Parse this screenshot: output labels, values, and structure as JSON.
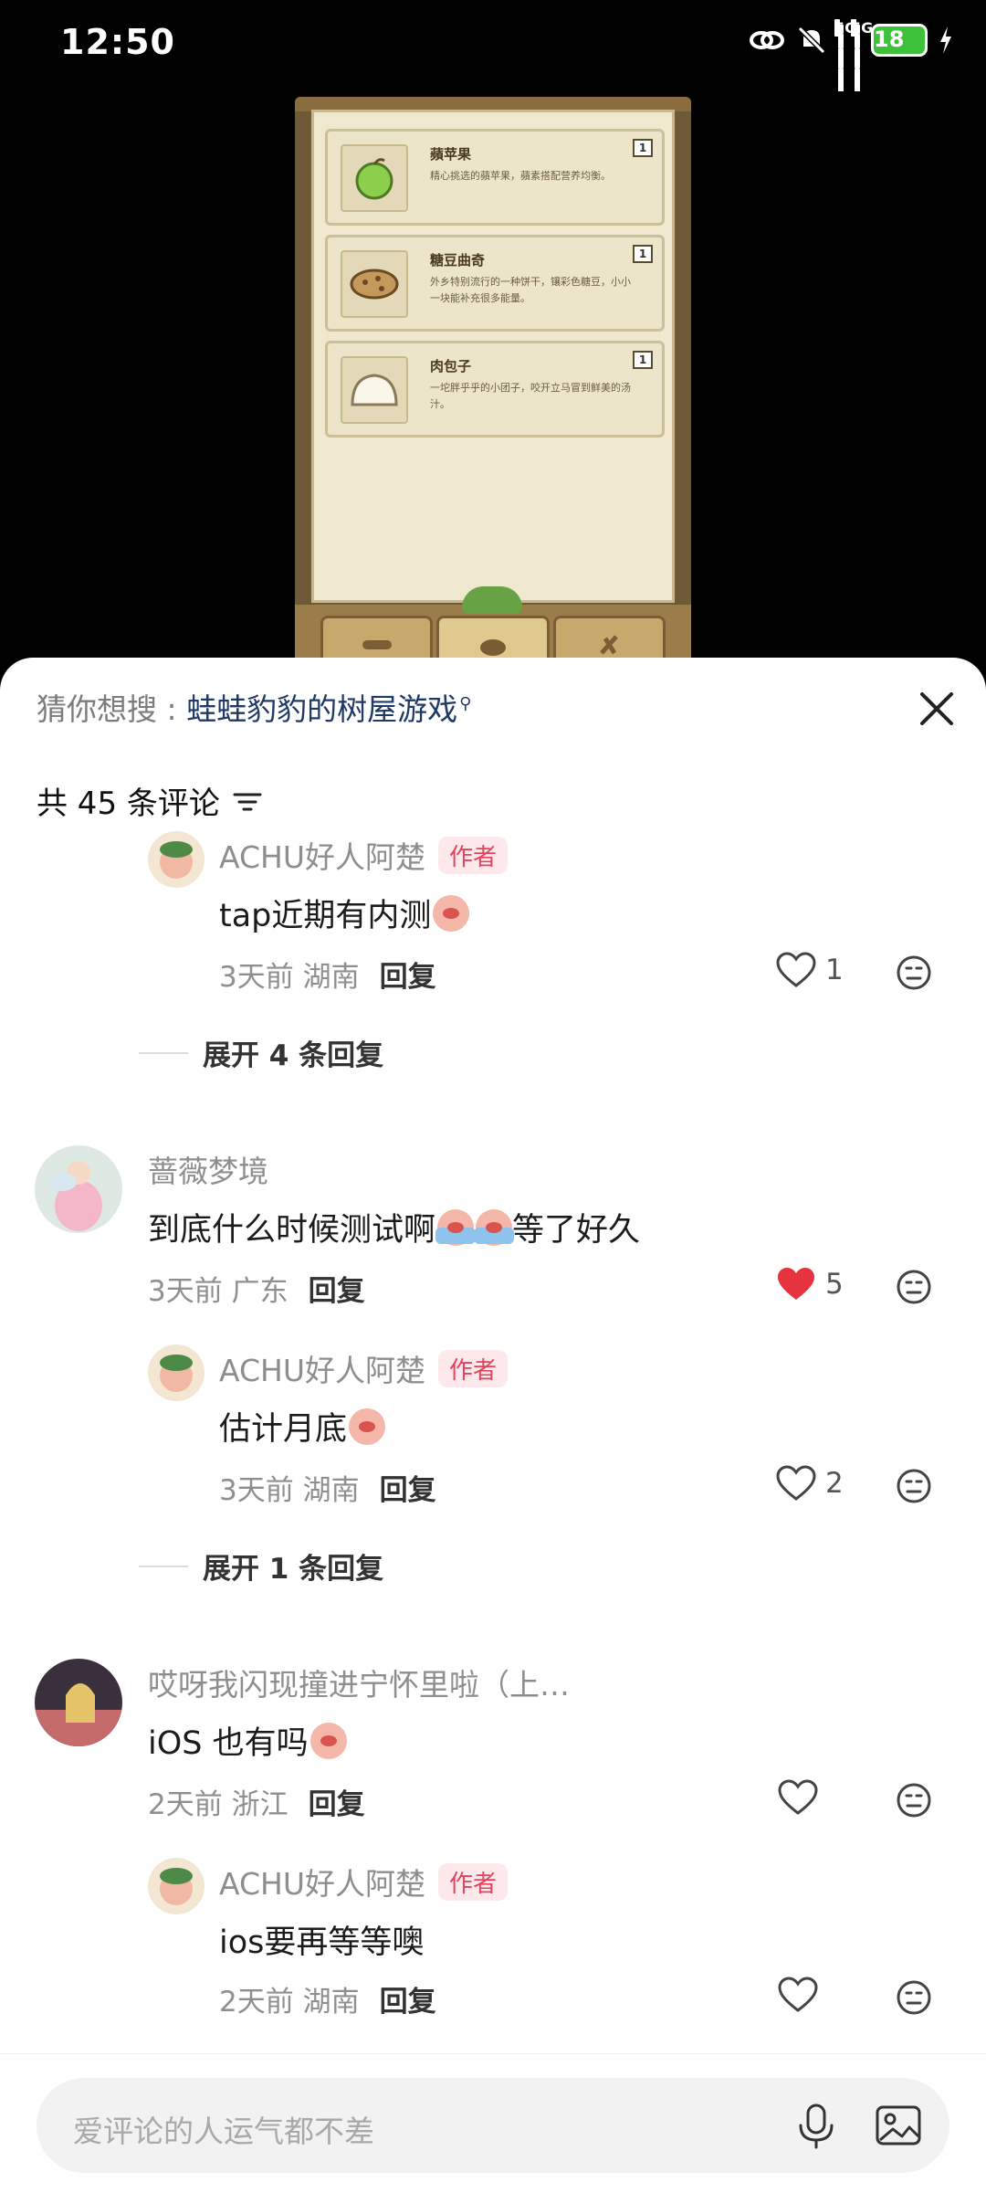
{
  "status_bar": {
    "time": "12:50",
    "signal1": "5G",
    "signal2": "5G",
    "battery": "18"
  },
  "game": {
    "items": [
      {
        "name": "蘋苹果",
        "desc": "精心挑选的蘋苹果，蘋素搭配营养均衡。",
        "count": "1"
      },
      {
        "name": "糖豆曲奇",
        "desc": "外乡特别流行的一种饼干，镶彩色糖豆，小小一块能补充很多能量。",
        "count": "1"
      },
      {
        "name": "肉包子",
        "desc": "一坨胖乎乎的小团子，咬开立马冒到鲜美的汤汁。",
        "count": "1"
      }
    ]
  },
  "sheet": {
    "suggest_label": "猜你想搜 : ",
    "suggest_keyword": "蛙蛙豹豹的树屋游戏",
    "comment_count": "共 45 条评论"
  },
  "comments": [
    {
      "user": "ACHU好人阿楚",
      "badge": "作者",
      "text": "tap近期有内测",
      "time": "3天前",
      "region": "湖南",
      "reply": "回复",
      "likes": "1"
    },
    {
      "expand": "展开 4 条回复"
    },
    {
      "user": "蔷薇梦境",
      "text": "到底什么时候测试啊",
      "text_tail": "等了好久",
      "time": "3天前",
      "region": "广东",
      "reply": "回复",
      "likes": "5"
    },
    {
      "user": "ACHU好人阿楚",
      "badge": "作者",
      "text": "估计月底",
      "time": "3天前",
      "region": "湖南",
      "reply": "回复",
      "likes": "2"
    },
    {
      "expand": "展开 1 条回复"
    },
    {
      "user": "哎呀我闪现撞进宁怀里啦（上…",
      "text": "iOS 也有吗",
      "time": "2天前",
      "region": "浙江",
      "reply": "回复",
      "likes": ""
    },
    {
      "user": "ACHU好人阿楚",
      "badge": "作者",
      "text": "ios要再等等噢",
      "time": "2天前",
      "region": "湖南",
      "reply": "回复",
      "likes": ""
    }
  ],
  "input": {
    "placeholder": "爱评论的人运气都不差"
  },
  "colors": {
    "like_red": "#e5343f",
    "badge_bg": "#fde9ec",
    "badge_text": "#e5425c",
    "keyword": "#1f3a66"
  },
  "icons": [
    "close-icon",
    "filter-icon",
    "heart-icon",
    "emoji-icon",
    "mic-icon",
    "image-icon"
  ]
}
